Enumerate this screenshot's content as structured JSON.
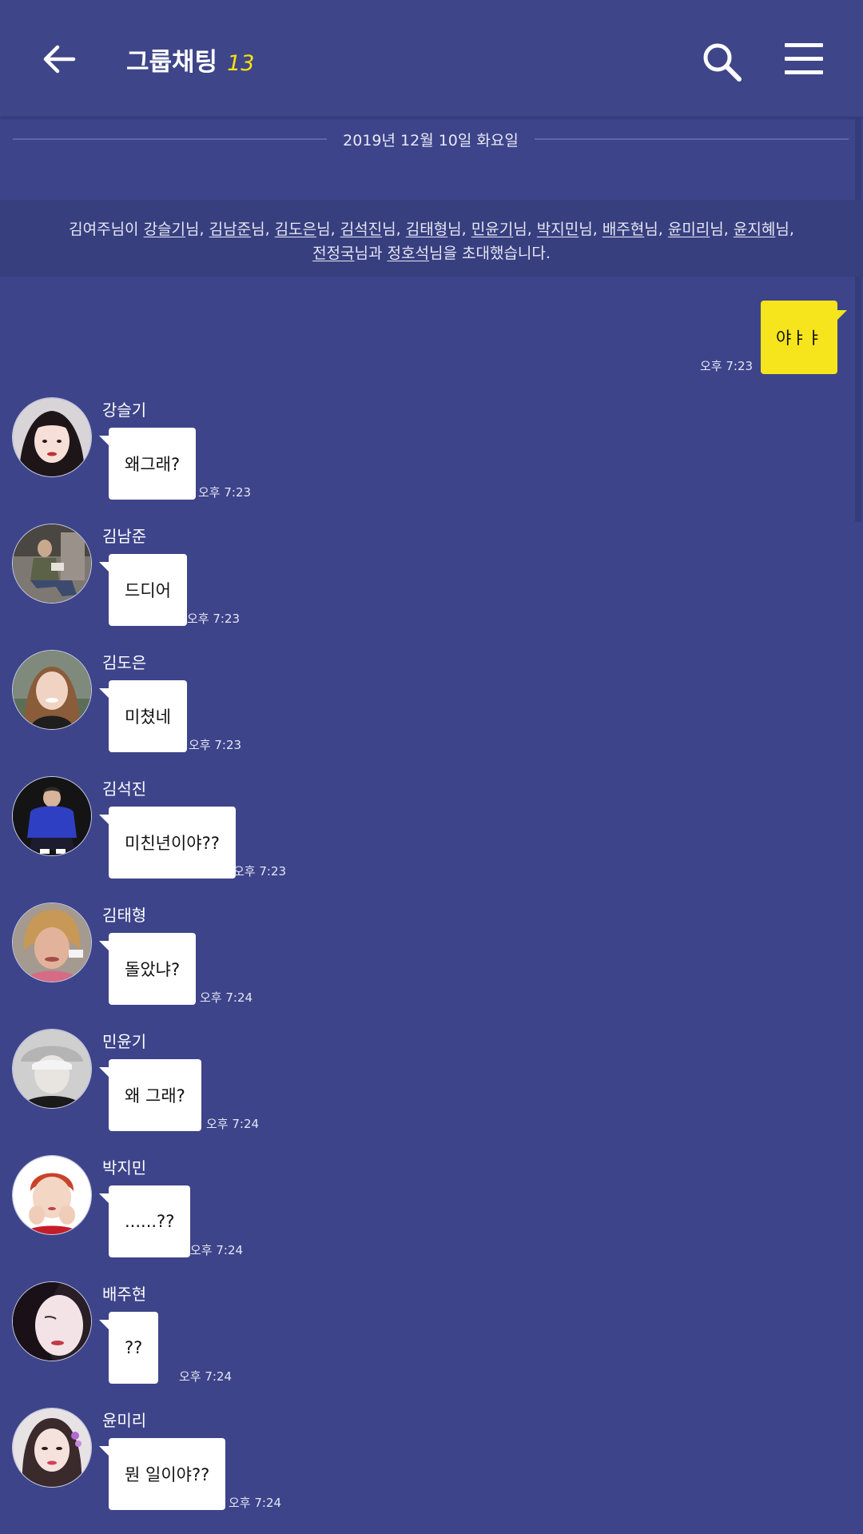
{
  "header": {
    "title": "그룹채팅",
    "member_count": "13"
  },
  "date_divider": "2019년 12월 10일 화요일",
  "system_message": {
    "inviter": "김여주님이",
    "line1_names": [
      "강슬기",
      "김남준",
      "김도은",
      "김석진",
      "김태형",
      "민윤기",
      "박지민",
      "배주현",
      "윤미리",
      "윤지혜"
    ],
    "line2_names": [
      "전정국",
      "정호석"
    ],
    "name_suffix": "님",
    "joiner": "과",
    "ending": "님을 초대했습니다."
  },
  "my_message": {
    "text": "야ㅑㅑ",
    "time": "오후 7:23"
  },
  "messages": [
    {
      "sender": "강슬기",
      "text": "왜그래?",
      "time": "오후 7:23"
    },
    {
      "sender": "김남준",
      "text": "드디어",
      "time": "오후 7:23"
    },
    {
      "sender": "김도은",
      "text": "미쳤네",
      "time": "오후 7:23"
    },
    {
      "sender": "김석진",
      "text": "미친년이야??",
      "time": "오후 7:23"
    },
    {
      "sender": "김태형",
      "text": "돌았냐?",
      "time": "오후 7:24"
    },
    {
      "sender": "민윤기",
      "text": "왜 그래?",
      "time": "오후 7:24"
    },
    {
      "sender": "박지민",
      "text": "......??",
      "time": "오후 7:24"
    },
    {
      "sender": "배주현",
      "text": "??",
      "time": "오후 7:24"
    },
    {
      "sender": "윤미리",
      "text": "뭔 일이야??",
      "time": "오후 7:24"
    }
  ],
  "colors": {
    "background": "#3d448a",
    "my_bubble": "#f6e41c",
    "other_bubble": "#ffffff",
    "member_count": "#f6e30f"
  }
}
